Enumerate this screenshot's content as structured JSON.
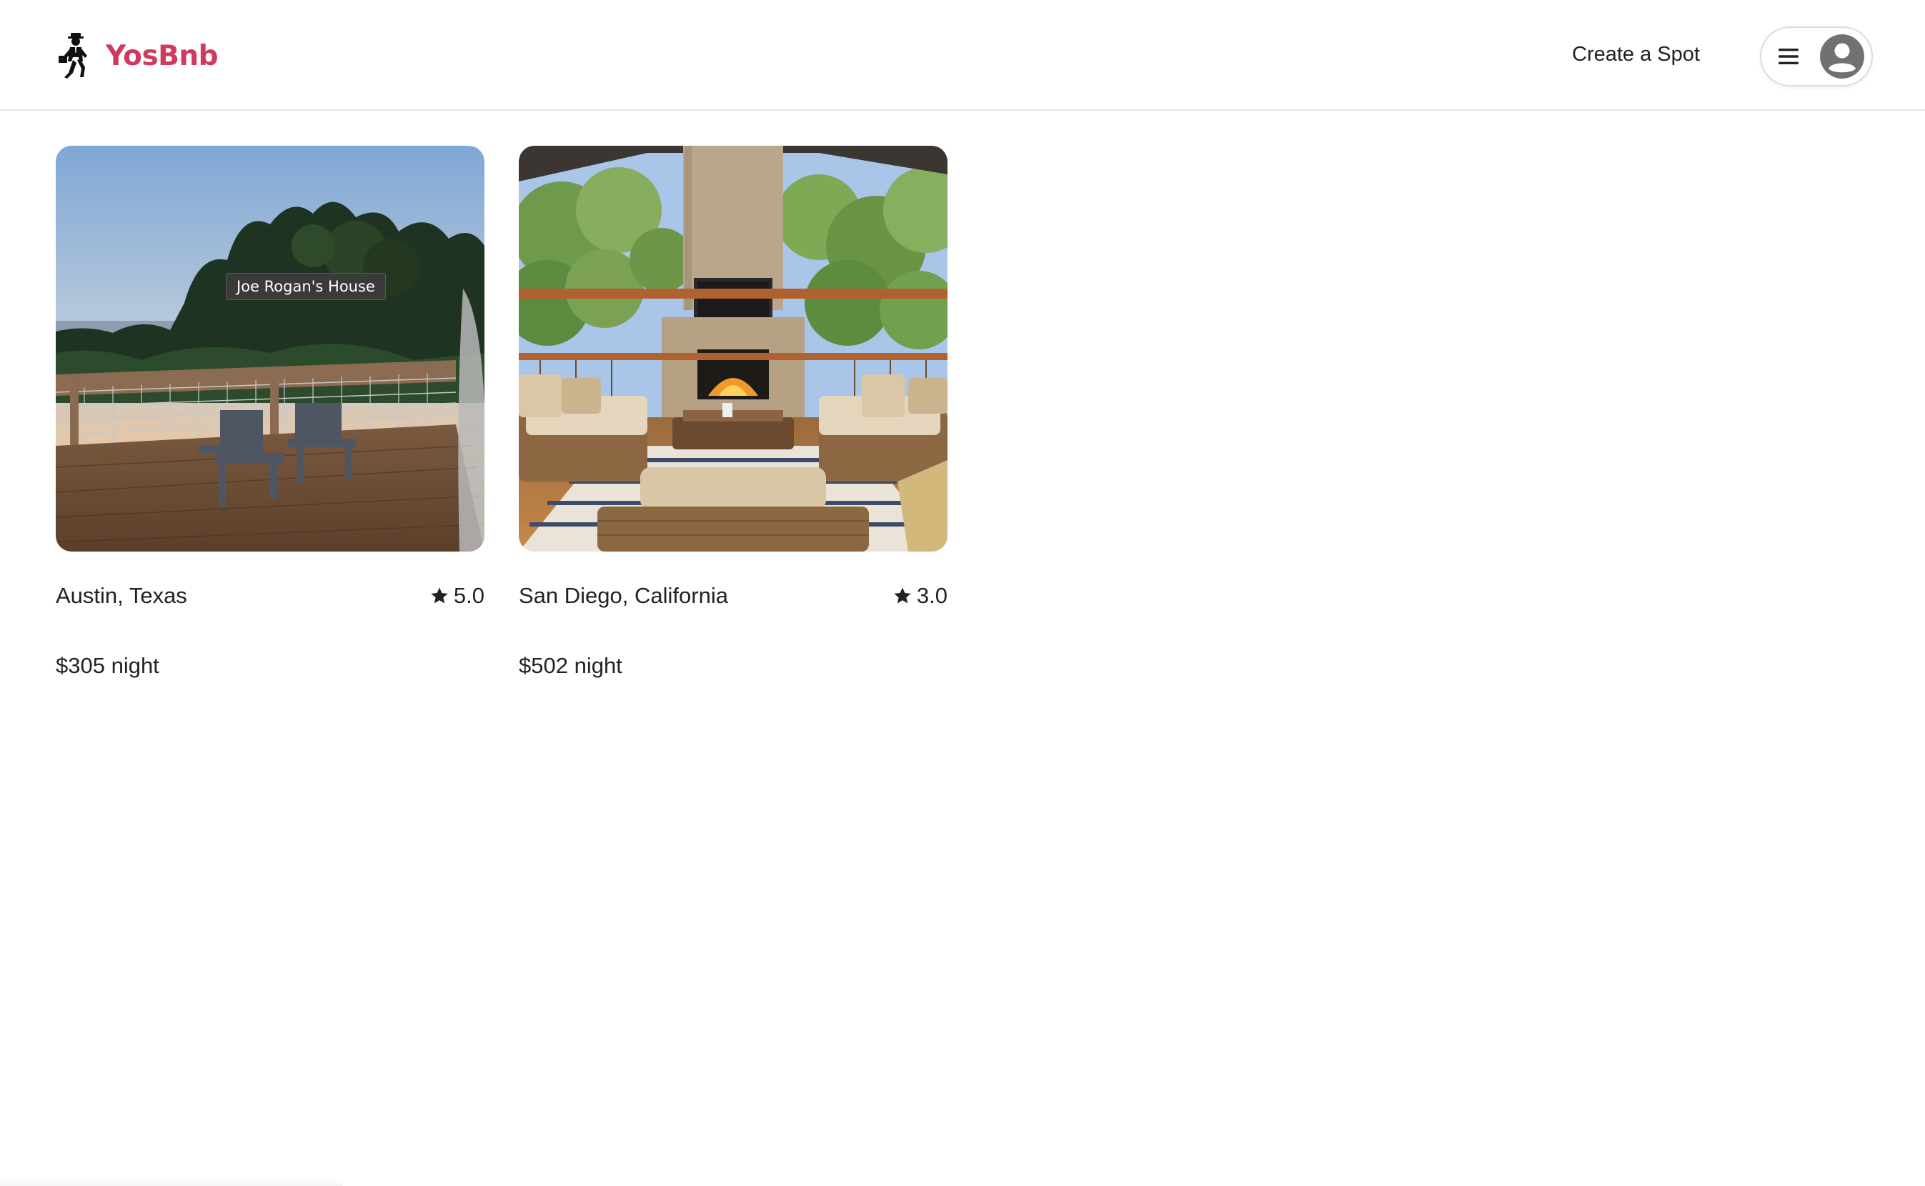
{
  "header": {
    "brand_name": "YosBnb",
    "brand_color": "#d03a5e",
    "logo_icon": "walking-man-icon",
    "create_spot_label": "Create a Spot",
    "menu_icon": "hamburger-menu-icon",
    "avatar_icon": "user-circle-icon"
  },
  "spots": [
    {
      "location": "Austin, Texas",
      "rating": "5.0",
      "price": "$305 night",
      "tooltip": "Joe Rogan's House",
      "image": "wooden deck with two adirondack chairs overlooking forest at sunset"
    },
    {
      "location": "San Diego, California",
      "rating": "3.0",
      "price": "$502 night",
      "image": "covered outdoor living room with stone fireplace, wicker sofas and forest view"
    }
  ]
}
